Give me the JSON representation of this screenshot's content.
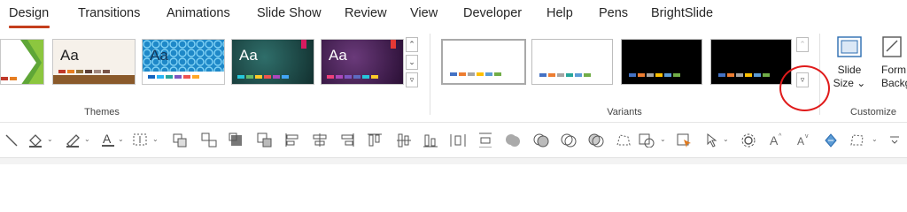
{
  "tabs": [
    {
      "label": "Design",
      "active": true
    },
    {
      "label": "Transitions"
    },
    {
      "label": "Animations"
    },
    {
      "label": "Slide Show"
    },
    {
      "label": "Review"
    },
    {
      "label": "View"
    },
    {
      "label": "Developer"
    },
    {
      "label": "Help"
    },
    {
      "label": "Pens"
    },
    {
      "label": "BrightSlide"
    }
  ],
  "themes": {
    "group_label": "Themes",
    "items": [
      {
        "aa": ""
      },
      {
        "aa": "Aa"
      },
      {
        "aa": "Aa"
      },
      {
        "aa": "Aa"
      },
      {
        "aa": "Aa"
      }
    ],
    "scroll_up": "⌃",
    "scroll_down": "⌄",
    "more": "▿"
  },
  "variants": {
    "group_label": "Variants",
    "more": "▿"
  },
  "customize": {
    "group_label": "Customize",
    "slide_size_line1": "Slide",
    "slide_size_line2": "Size ⌄",
    "format_bg_line1": "Form",
    "format_bg_line2": "Backgr"
  },
  "colors": {
    "accent": "#c43e1c",
    "annotation": "#e01b1b"
  }
}
